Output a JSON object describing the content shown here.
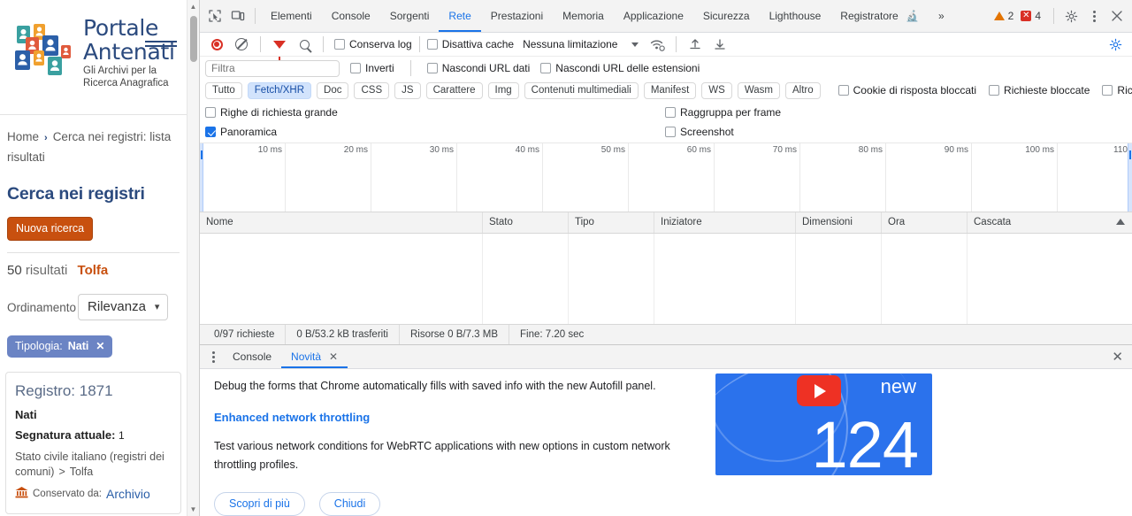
{
  "webpage": {
    "brand": {
      "title_line1": "Portale",
      "title_line2": "Antenati",
      "subtitle": "Gli Archivi per la Ricerca Anagrafica",
      "logo_icon": "people-group-logo"
    },
    "breadcrumb": {
      "home": "Home",
      "separator": "›",
      "current": "Cerca nei registri: lista risultati"
    },
    "heading": "Cerca nei registri",
    "new_search_button": "Nuova ricerca",
    "results": {
      "count": "50",
      "label": "risultati",
      "place": "Tolfa"
    },
    "sort": {
      "label": "Ordinamento",
      "value": "Rilevanza",
      "chevron": "⌄"
    },
    "filter_chip": {
      "key": "Tipologia:",
      "value": "Nati",
      "remove": "✕"
    },
    "result_card": {
      "register": "Registro: 1871",
      "type": "Nati",
      "signature_label": "Segnatura attuale:",
      "signature_value": "1",
      "path_root": "Stato civile italiano (registri dei comuni)",
      "path_sep": ">",
      "path_leaf": "Tolfa",
      "keeper_label": "Conservato da:",
      "keeper_value": "Archivio",
      "keeper_icon": "bank-icon"
    }
  },
  "devtools": {
    "tabs": [
      {
        "label": "Elementi",
        "active": false
      },
      {
        "label": "Console",
        "active": false
      },
      {
        "label": "Sorgenti",
        "active": false
      },
      {
        "label": "Rete",
        "active": true
      },
      {
        "label": "Prestazioni",
        "active": false
      },
      {
        "label": "Memoria",
        "active": false
      },
      {
        "label": "Applicazione",
        "active": false
      },
      {
        "label": "Sicurezza",
        "active": false
      },
      {
        "label": "Lighthouse",
        "active": false
      },
      {
        "label": "Registratore",
        "active": false
      }
    ],
    "more_tabs": "»",
    "warnings_count": "2",
    "errors_count": "4",
    "toolbar_icons": {
      "inspect": "inspect-element-icon",
      "device": "device-toolbar-icon",
      "settings": "gear-icon",
      "menu": "kebab-menu-icon",
      "close": "close-icon",
      "record": "record-icon",
      "clear": "clear-icon",
      "filter": "filter-funnel-icon",
      "search": "search-icon",
      "network_conditions": "network-conditions-icon",
      "import_har": "upload-icon",
      "export_har": "download-icon"
    },
    "controls": {
      "preserve_log": {
        "label": "Conserva log",
        "checked": false
      },
      "disable_cache": {
        "label": "Disattiva cache",
        "checked": false
      },
      "throttling": "Nessuna limitazione"
    },
    "filter_input": {
      "placeholder": "Filtra",
      "value": ""
    },
    "filter_checkboxes": [
      {
        "label": "Inverti",
        "checked": false
      },
      {
        "label": "Nascondi URL dati",
        "checked": false
      },
      {
        "label": "Nascondi URL delle estensioni",
        "checked": false
      }
    ],
    "type_filters": [
      {
        "label": "Tutto",
        "active": false
      },
      {
        "label": "Fetch/XHR",
        "active": true
      },
      {
        "label": "Doc",
        "active": false
      },
      {
        "label": "CSS",
        "active": false
      },
      {
        "label": "JS",
        "active": false
      },
      {
        "label": "Carattere",
        "active": false
      },
      {
        "label": "Img",
        "active": false
      },
      {
        "label": "Contenuti multimediali",
        "active": false
      },
      {
        "label": "Manifest",
        "active": false
      },
      {
        "label": "WS",
        "active": false
      },
      {
        "label": "Wasm",
        "active": false
      },
      {
        "label": "Altro",
        "active": false
      }
    ],
    "extra_filters": [
      {
        "label": "Cookie di risposta bloccati",
        "checked": false
      },
      {
        "label": "Richieste bloccate",
        "checked": false
      },
      {
        "label": "Richieste di terze parti",
        "checked": false
      }
    ],
    "options": [
      {
        "label": "Righe di richiesta grande",
        "checked": false
      },
      {
        "label": "Panoramica",
        "checked": true
      },
      {
        "label": "Raggruppa per frame",
        "checked": false
      },
      {
        "label": "Screenshot",
        "checked": false
      }
    ],
    "timeline_ticks": [
      "10 ms",
      "20 ms",
      "30 ms",
      "40 ms",
      "50 ms",
      "60 ms",
      "70 ms",
      "80 ms",
      "90 ms",
      "100 ms",
      "110"
    ],
    "table_columns": [
      "Nome",
      "Stato",
      "Tipo",
      "Iniziatore",
      "Dimensioni",
      "Ora",
      "Cascata"
    ],
    "table_rows": [],
    "status_bar": [
      "0/97 richieste",
      "0 B/53.2 kB trasferiti",
      "Risorse 0 B/7.3 MB",
      "Fine: 7.20 sec"
    ],
    "drawer": {
      "tabs": [
        {
          "label": "Console",
          "active": false,
          "closable": false
        },
        {
          "label": "Novità",
          "active": true,
          "closable": true
        }
      ],
      "close_icon": "close-icon",
      "whats_new": {
        "paragraph1": "Debug the forms that Chrome automatically fills with saved info with the new Autofill panel.",
        "heading": "Enhanced network throttling",
        "paragraph2": "Test various network conditions for WebRTC applications with new options in custom network throttling profiles.",
        "buttons": {
          "learn_more": "Scopri di più",
          "close": "Chiudi"
        },
        "image": {
          "version": "124",
          "badge": "new",
          "play_icon": "youtube-play-icon"
        }
      }
    }
  },
  "colors": {
    "brand_blue": "#2b4a7e",
    "accent_orange": "#c8500f",
    "chip_blue": "#6b84c4",
    "devtools_blue": "#1a73e8",
    "error_red": "#d93025",
    "warning_orange": "#e37400",
    "promo_blue": "#2b72ec"
  }
}
